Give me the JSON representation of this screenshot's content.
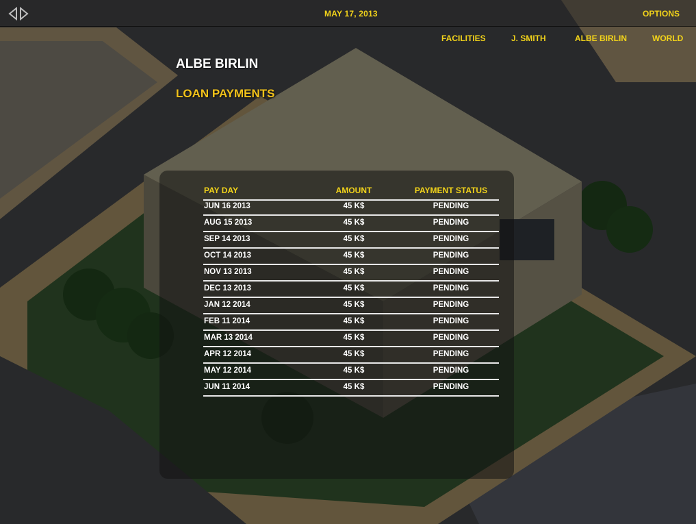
{
  "header": {
    "date": "MAY 17, 2013",
    "options_label": "OPTIONS",
    "nav_arrows_icon": "left-right-arrows-icon"
  },
  "nav": {
    "items": [
      {
        "label": "FACILITIES"
      },
      {
        "label": "J. SMITH"
      },
      {
        "label": "ALBE BIRLIN"
      },
      {
        "label": "WORLD"
      }
    ]
  },
  "page": {
    "title": "ALBE BIRLIN",
    "section": "LOAN PAYMENTS"
  },
  "table": {
    "columns": [
      "PAY DAY",
      "AMOUNT",
      "PAYMENT STATUS"
    ],
    "rows": [
      {
        "pay_day": "JUN 16 2013",
        "amount": "45 K$",
        "status": "PENDING"
      },
      {
        "pay_day": "AUG 15 2013",
        "amount": "45 K$",
        "status": "PENDING"
      },
      {
        "pay_day": "SEP 14 2013",
        "amount": "45 K$",
        "status": "PENDING"
      },
      {
        "pay_day": "OCT 14 2013",
        "amount": "45 K$",
        "status": "PENDING"
      },
      {
        "pay_day": "NOV 13 2013",
        "amount": "45 K$",
        "status": "PENDING"
      },
      {
        "pay_day": "DEC 13 2013",
        "amount": "45 K$",
        "status": "PENDING"
      },
      {
        "pay_day": "JAN 12 2014",
        "amount": "45 K$",
        "status": "PENDING"
      },
      {
        "pay_day": "FEB 11 2014",
        "amount": "45 K$",
        "status": "PENDING"
      },
      {
        "pay_day": "MAR 13 2014",
        "amount": "45 K$",
        "status": "PENDING"
      },
      {
        "pay_day": "APR 12 2014",
        "amount": "45 K$",
        "status": "PENDING"
      },
      {
        "pay_day": "MAY 12 2014",
        "amount": "45 K$",
        "status": "PENDING"
      },
      {
        "pay_day": "JUN 11 2014",
        "amount": "45 K$",
        "status": "PENDING"
      }
    ]
  },
  "colors": {
    "accent_yellow": "#f2d31a",
    "title_gold": "#f2c21a",
    "text_white": "#ffffff"
  }
}
